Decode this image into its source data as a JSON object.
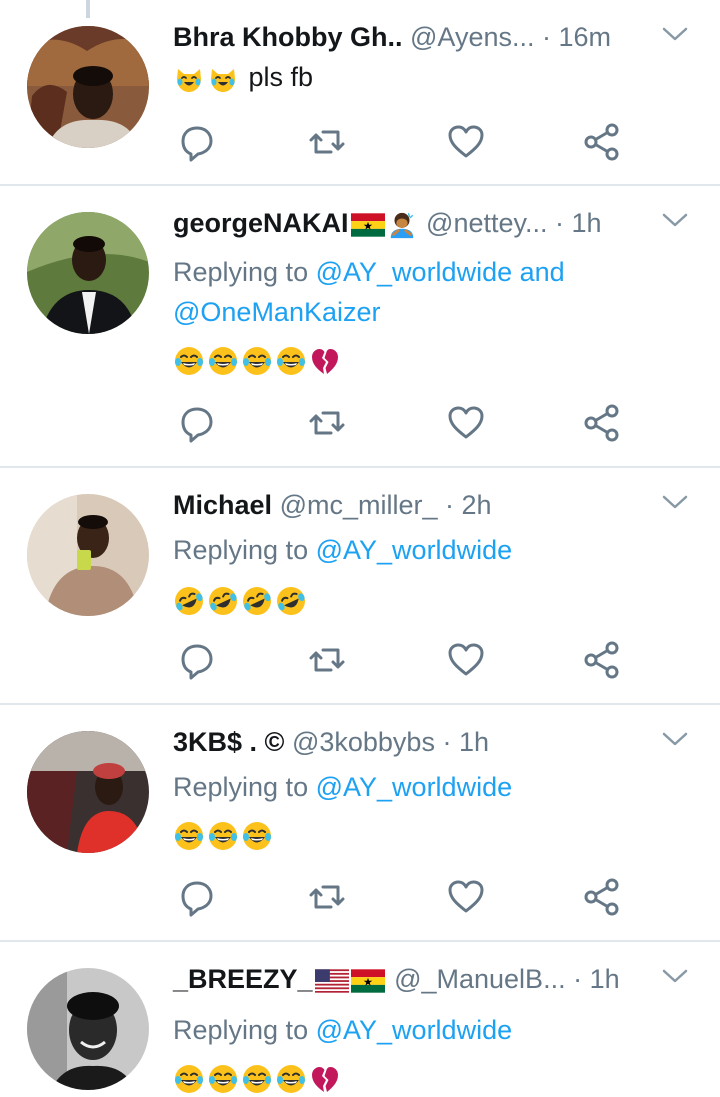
{
  "colors": {
    "accent": "#1da1f2",
    "muted": "#657786",
    "text": "#14171a",
    "divider": "#e1e8ed"
  },
  "icons": {
    "reply": "reply-icon",
    "retweet": "retweet-icon",
    "like": "heart-icon",
    "share": "share-icon",
    "more": "chevron-down-icon"
  },
  "tweets": [
    {
      "name": "Bhra Khobby Gh..",
      "handle": "@Ayens...",
      "dot": "·",
      "time": "16m",
      "text": "pls fb",
      "emojis": [
        "crying-cat",
        "crying-cat"
      ]
    },
    {
      "name": "georgeNAKAI",
      "name_emojis": [
        "ghana-flag",
        "person-bowing"
      ],
      "handle": "@nettey...",
      "dot": "·",
      "time": "1h",
      "reply_prefix": "Replying to",
      "reply_mention_1": "@AY_worldwide",
      "reply_and": "and",
      "reply_mention_2": "@OneManKaizer",
      "emojis": [
        "tears-of-joy",
        "tears-of-joy",
        "tears-of-joy",
        "tears-of-joy",
        "broken-heart"
      ]
    },
    {
      "name": "Michael",
      "handle": "@mc_miller_",
      "dot": "·",
      "time": "2h",
      "reply_prefix": "Replying to",
      "reply_mention_1": "@AY_worldwide",
      "emojis": [
        "rolling-laughing",
        "rolling-laughing",
        "rolling-laughing",
        "rolling-laughing"
      ]
    },
    {
      "name": "3KB$ . ©",
      "handle": "@3kobbybs",
      "dot": "·",
      "time": "1h",
      "reply_prefix": "Replying to",
      "reply_mention_1": "@AY_worldwide",
      "emojis": [
        "tears-of-joy",
        "tears-of-joy",
        "tears-of-joy"
      ]
    },
    {
      "name": "_BREEZY_",
      "name_emojis": [
        "us-flag",
        "ghana-flag"
      ],
      "handle": "@_ManuelB...",
      "dot": "·",
      "time": "1h",
      "reply_prefix": "Replying to",
      "reply_mention_1": "@AY_worldwide",
      "emojis": [
        "tears-of-joy",
        "tears-of-joy",
        "tears-of-joy",
        "tears-of-joy",
        "broken-heart"
      ]
    }
  ]
}
